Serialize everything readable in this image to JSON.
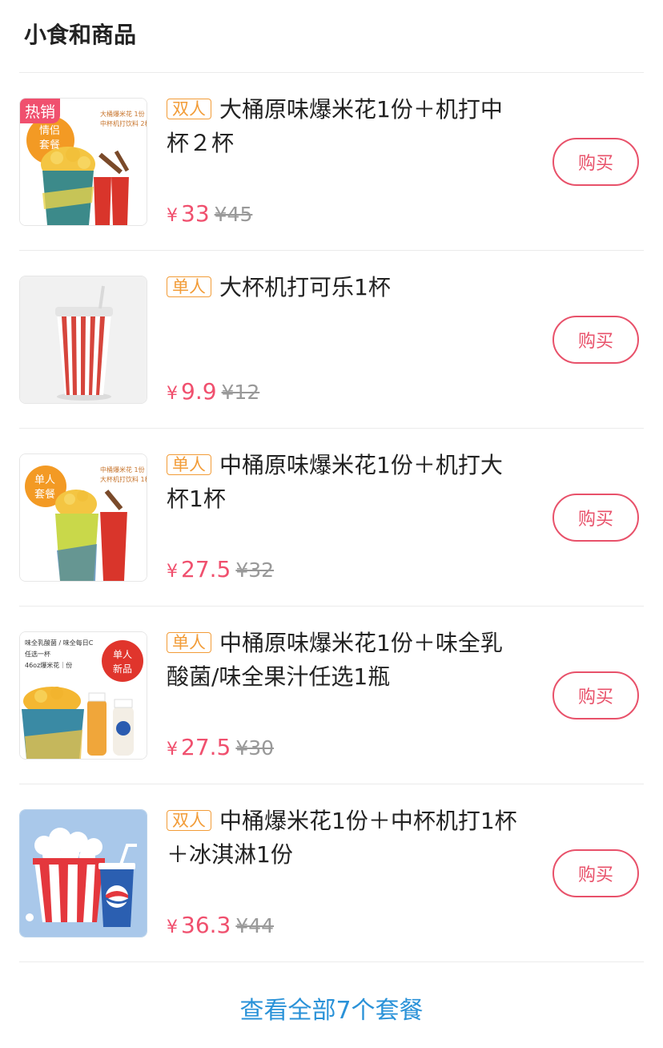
{
  "section": {
    "title": "小食和商品"
  },
  "items": [
    {
      "tag": "双人",
      "name": "大桶原味爆米花1份＋机打中杯２杯",
      "currency": "¥",
      "price": "33",
      "original": "¥45",
      "buy_label": "购买",
      "badge": "热销",
      "thumb_text": {
        "circle": "情侣套餐",
        "note": "大桶爆米花 1份\n中杯机打饮料 2杯"
      }
    },
    {
      "tag": "单人",
      "name": "大杯机打可乐1杯",
      "currency": "¥",
      "price": "9.9",
      "original": "¥12",
      "buy_label": "购买"
    },
    {
      "tag": "单人",
      "name": "中桶原味爆米花1份＋机打大杯1杯",
      "currency": "¥",
      "price": "27.5",
      "original": "¥32",
      "buy_label": "购买",
      "thumb_text": {
        "circle": "单人套餐",
        "note": "中桶爆米花 1份\n大杯机打饮料 1杯"
      }
    },
    {
      "tag": "单人",
      "name": "中桶原味爆米花1份＋味全乳酸菌/味全果汁任选1瓶",
      "currency": "¥",
      "price": "27.5",
      "original": "¥30",
      "buy_label": "购买",
      "thumb_text": {
        "circle": "单人新品",
        "note": "味全乳酸菌 / 味全每日C\n任选一杯\n46oz爆米花｜份"
      }
    },
    {
      "tag": "双人",
      "name": "中桶爆米花1份＋中杯机打1杯＋冰淇淋1份",
      "currency": "¥",
      "price": "36.3",
      "original": "¥44",
      "buy_label": "购买"
    }
  ],
  "footer": {
    "view_all": "查看全部7个套餐"
  },
  "colors": {
    "accent": "#f0506e",
    "tag": "#f29c38",
    "link": "#2a92d8"
  }
}
